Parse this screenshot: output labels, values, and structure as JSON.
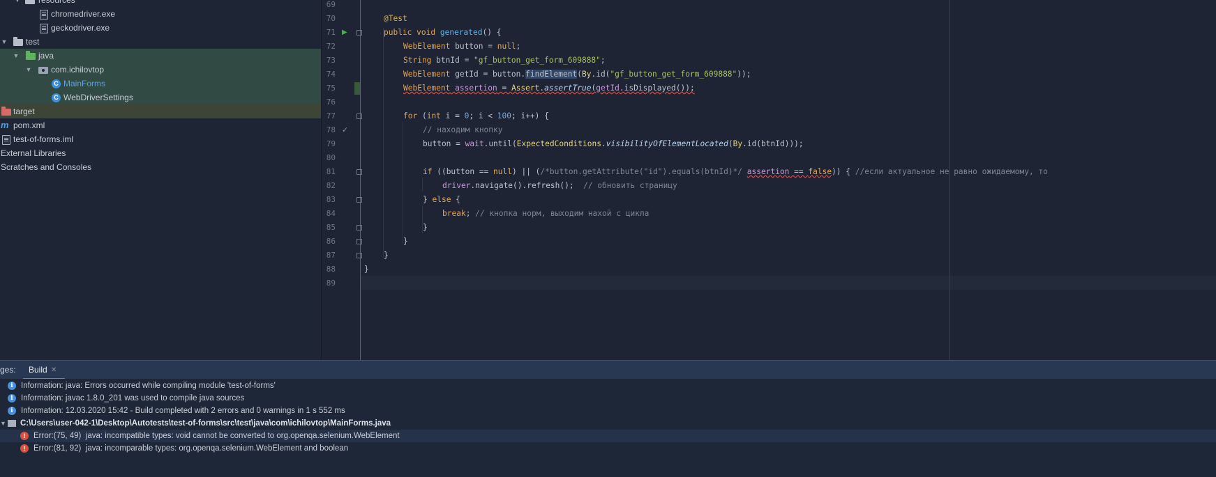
{
  "project_tree": {
    "items": [
      {
        "label": "resources",
        "type": "folder"
      },
      {
        "label": "chromedriver.exe",
        "type": "file"
      },
      {
        "label": "geckodriver.exe",
        "type": "file"
      },
      {
        "label": "test",
        "type": "folder"
      },
      {
        "label": "java",
        "type": "source-folder"
      },
      {
        "label": "com.ichilovtop",
        "type": "package"
      },
      {
        "label": "MainForms",
        "type": "class"
      },
      {
        "label": "WebDriverSettings",
        "type": "class"
      },
      {
        "label": "target",
        "type": "excluded-folder"
      },
      {
        "label": "pom.xml",
        "type": "maven"
      },
      {
        "label": "test-of-forms.iml",
        "type": "module"
      },
      {
        "label": "External Libraries",
        "type": "group"
      },
      {
        "label": "Scratches and Consoles",
        "type": "group"
      }
    ]
  },
  "editor": {
    "line_numbers": [
      "69",
      "70",
      "71",
      "72",
      "73",
      "74",
      "75",
      "76",
      "77",
      "78",
      "79",
      "80",
      "81",
      "82",
      "83",
      "84",
      "85",
      "86",
      "87",
      "88",
      "89"
    ],
    "tokens": {
      "l70": [
        "@Test"
      ],
      "l71": [
        "public",
        " ",
        "void",
        " ",
        "generated",
        "() {"
      ],
      "l72": [
        "WebElement",
        " button = ",
        "null",
        ";"
      ],
      "l73": [
        "String",
        " btnId = ",
        "\"gf_button_get_form_609888\"",
        ";"
      ],
      "l74": [
        "WebElement",
        " getId = button.",
        "findElement",
        "(",
        "By",
        ".id(",
        "\"gf_button_get_form_609888\"",
        "));"
      ],
      "l75": [
        "WebElement",
        " ",
        "assertion",
        " = ",
        "Assert",
        ".",
        "assertTrue",
        "(",
        "getId",
        ".isDisplayed());"
      ],
      "l77": [
        "for",
        " (",
        "int",
        " i = ",
        "0",
        "; i < ",
        "100",
        "; i++) {"
      ],
      "l78": [
        "// находим кнопку"
      ],
      "l79": [
        "button = ",
        "wait",
        ".until(",
        "ExpectedConditions",
        ".",
        "visibilityOfElementLocated",
        "(",
        "By",
        ".id(btnId)));"
      ],
      "l81": [
        "if",
        " ((button == ",
        "null",
        ") || (",
        "/*button.getAttribute(\"id\").equals(btnId)*/",
        " ",
        "assertion",
        " == ",
        "false",
        ")) { ",
        "//если актуальное не равно ожидаемому, то"
      ],
      "l82": [
        "driver",
        ".navigate().refresh();  ",
        "// обновить страницу"
      ],
      "l83": [
        "} ",
        "else",
        " {"
      ],
      "l84": [
        "break",
        "; ",
        "// кнопка норм, выходим нахой с цикла"
      ],
      "l85": [
        "}"
      ],
      "l86": [
        "}"
      ],
      "l87": [
        "}"
      ],
      "l88": [
        "}"
      ]
    }
  },
  "build_panel": {
    "tab_prefix": "ges:",
    "tab_label": "Build",
    "messages": [
      {
        "level": "info",
        "text": "Information: java: Errors occurred while compiling module 'test-of-forms'"
      },
      {
        "level": "info",
        "text": "Information: javac 1.8.0_201 was used to compile java sources"
      },
      {
        "level": "info",
        "text": "Information: 12.03.2020 15:42 - Build completed with 2 errors and 0 warnings in 1 s 552 ms"
      },
      {
        "level": "path",
        "text": "C:\\Users\\user-042-1\\Desktop\\Autotests\\test-of-forms\\src\\test\\java\\com\\ichilovtop\\MainForms.java"
      },
      {
        "level": "error",
        "location": "Error:(75, 49)",
        "text": "java: incompatible types: void cannot be converted to org.openqa.selenium.WebElement"
      },
      {
        "level": "error",
        "location": "Error:(81, 92)",
        "text": "java: incomparable types: org.openqa.selenium.WebElement and boolean"
      }
    ]
  },
  "colors": {
    "keyword": "#e6a650",
    "string": "#a5c261",
    "number": "#7aa6da",
    "comment": "#7d8696",
    "function": "#5fb4e8",
    "panel_header": "#283852"
  }
}
